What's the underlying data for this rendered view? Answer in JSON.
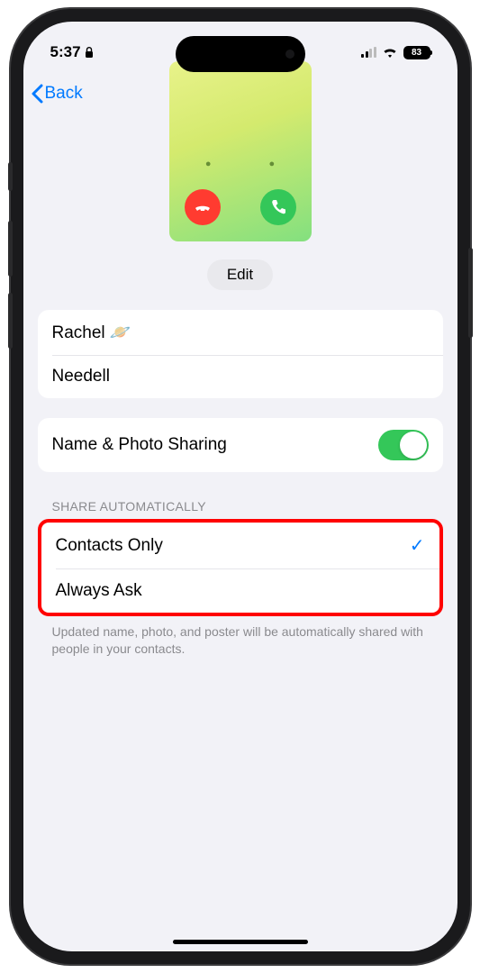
{
  "status": {
    "time": "5:37",
    "battery_text": "83"
  },
  "nav": {
    "back_label": "Back"
  },
  "edit_button": "Edit",
  "name_fields": {
    "first": "Rachel 🪐",
    "last": "Needell"
  },
  "sharing_row": {
    "label": "Name & Photo Sharing",
    "enabled": true
  },
  "share_automatically": {
    "header": "SHARE AUTOMATICALLY",
    "options": [
      {
        "label": "Contacts Only",
        "selected": true
      },
      {
        "label": "Always Ask",
        "selected": false
      }
    ],
    "footer": "Updated name, photo, and poster will be automatically shared with people in your contacts."
  }
}
